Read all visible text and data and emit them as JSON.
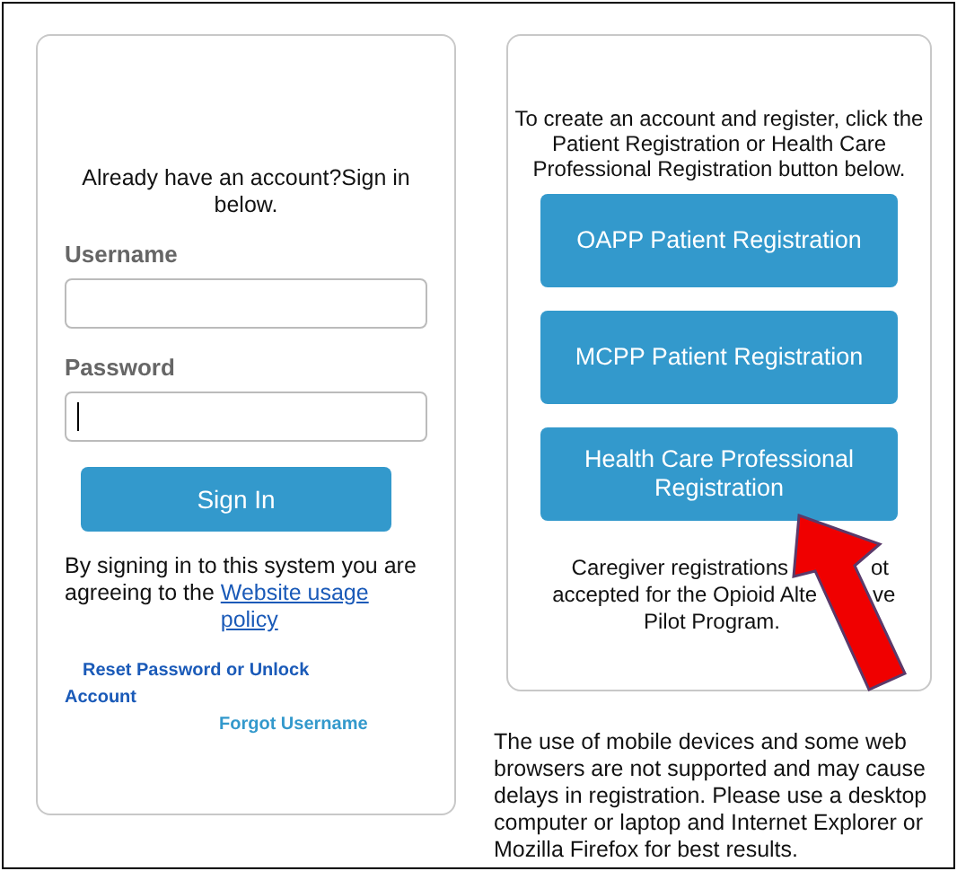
{
  "login": {
    "intro": "Already have an account?Sign in below.",
    "username": {
      "label": "Username"
    },
    "password": {
      "label": "Password",
      "focused": true
    },
    "sign_in_button": "Sign In",
    "agreement": "By signing in to this system you are agreeing to the",
    "agreement_link": "Website usage policy",
    "reset_link": "Reset Password or Unlock Account",
    "forgot_link": "Forgot Username"
  },
  "register": {
    "intro": "To create an account and register, click the Patient Registration or Health Care Professional Registration button below.",
    "buttons": [
      "OAPP Patient Registration",
      "MCPP Patient Registration",
      "Health Care Professional Registration"
    ],
    "note_lines": [
      {
        "left": "Caregiver registrations",
        "right": "ot"
      },
      {
        "left": "accepted for the Opioid Alte",
        "right": "ve"
      },
      {
        "left": "Pilot Program."
      }
    ]
  },
  "notice": "The use of mobile devices and some web browsers are not supported and may cause delays in registration. Please use a desktop computer or laptop and Internet Explorer or Mozilla Firefox for best results."
}
